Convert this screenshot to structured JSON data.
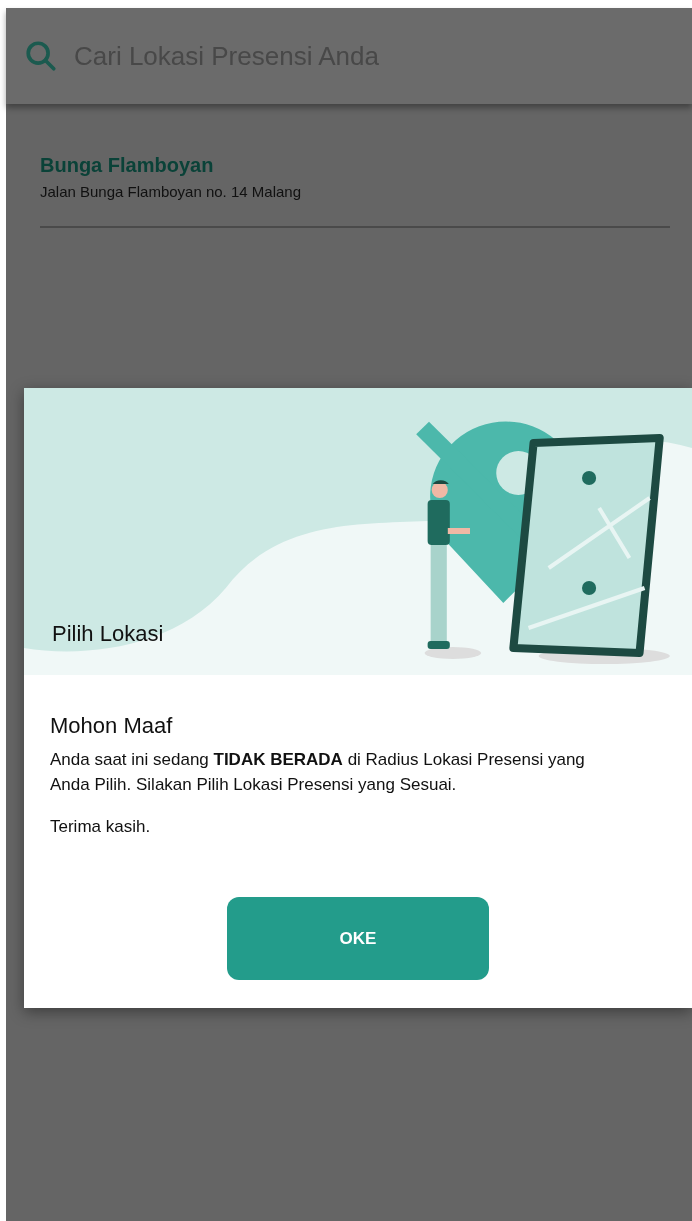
{
  "search": {
    "placeholder": "Cari Lokasi Presensi Anda"
  },
  "locations": [
    {
      "name": "Bunga Flamboyan",
      "address": "Jalan Bunga Flamboyan no. 14 Malang"
    }
  ],
  "dialog": {
    "title": "Pilih Lokasi",
    "heading": "Mohon Maaf",
    "message": "Anda saat ini sedang **TIDAK BERADA** di Radius Lokasi Presensi yang Anda Pilih. Silakan Pilih Lokasi Presensi yang Sesuai.",
    "closing": "Terima kasih.",
    "button": "OKE"
  }
}
